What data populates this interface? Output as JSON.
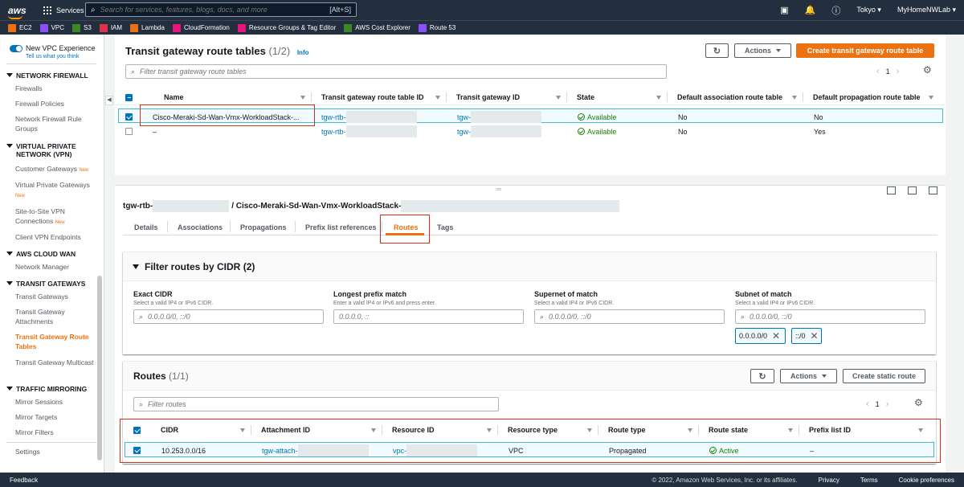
{
  "topbar": {
    "logo": "aws",
    "services": "Services",
    "search_placeholder": "Search for services, features, blogs, docs, and more",
    "search_shortcut": "[Alt+S]",
    "region": "Tokyo",
    "account": "MyHomeNWLab"
  },
  "favorites": [
    {
      "label": "EC2",
      "color": "#ec7211"
    },
    {
      "label": "VPC",
      "color": "#8c4fff"
    },
    {
      "label": "S3",
      "color": "#3f8624"
    },
    {
      "label": "IAM",
      "color": "#dd344c"
    },
    {
      "label": "Lambda",
      "color": "#ec7211"
    },
    {
      "label": "CloudFormation",
      "color": "#e7157b"
    },
    {
      "label": "Resource Groups & Tag Editor",
      "color": "#e7157b"
    },
    {
      "label": "AWS Cost Explorer",
      "color": "#3f8624"
    },
    {
      "label": "Route 53",
      "color": "#8c4fff"
    }
  ],
  "sidebar": {
    "vpc_experience": "New VPC Experience",
    "vpc_experience_sub": "Tell us what you think",
    "new_badge": "New",
    "sections": {
      "network_firewall": "NETWORK FIREWALL",
      "vpn": "VIRTUAL PRIVATE NETWORK (VPN)",
      "cloud_wan": "AWS CLOUD WAN",
      "transit_gateways": "TRANSIT GATEWAYS",
      "traffic_mirroring": "TRAFFIC MIRRORING"
    },
    "items": {
      "firewalls": "Firewalls",
      "firewall_policies": "Firewall Policies",
      "rule_groups": "Network Firewall Rule Groups",
      "customer_gateways": "Customer Gateways",
      "virtual_private_gateways": "Virtual Private Gateways",
      "s2s_vpn": "Site-to-Site VPN Connections",
      "client_vpn": "Client VPN Endpoints",
      "network_manager": "Network Manager",
      "transit_gateways": "Transit Gateways",
      "tgw_attachments": "Transit Gateway Attachments",
      "tgw_route_tables": "Transit Gateway Route Tables",
      "tgw_multicast": "Transit Gateway Multicast",
      "mirror_sessions": "Mirror Sessions",
      "mirror_targets": "Mirror Targets",
      "mirror_filters": "Mirror Filters",
      "settings": "Settings"
    }
  },
  "route_tables": {
    "title": "Transit gateway route tables",
    "count": "(1/2)",
    "info": "Info",
    "actions": "Actions",
    "create": "Create transit gateway route table",
    "filter_placeholder": "Filter transit gateway route tables",
    "page": "1",
    "columns": [
      "Name",
      "Transit gateway route table ID",
      "Transit gateway ID",
      "State",
      "Default association route table",
      "Default propagation route table"
    ],
    "rows": [
      {
        "name": "Cisco-Meraki-Sd-Wan-Vmx-WorkloadStack-...",
        "rtb": "tgw-rtb-",
        "tgw": "tgw-",
        "state": "Available",
        "assoc": "No",
        "prop": "No"
      },
      {
        "name": "–",
        "rtb": "tgw-rtb-",
        "tgw": "tgw-",
        "state": "Available",
        "assoc": "No",
        "prop": "Yes"
      }
    ]
  },
  "detail": {
    "title_rtb": "tgw-rtb-",
    "title_name": "/ Cisco-Meraki-Sd-Wan-Vmx-WorkloadStack-",
    "tabs": [
      "Details",
      "Associations",
      "Propagations",
      "Prefix list references",
      "Routes",
      "Tags"
    ]
  },
  "filter_routes": {
    "title": "Filter routes by CIDR",
    "count": "(2)",
    "fields": [
      {
        "label": "Exact CIDR",
        "desc": "Select a valid IP4 or IPv6 CIDR.",
        "placeholder": "0.0.0.0/0, ::/0"
      },
      {
        "label": "Longest prefix match",
        "desc": "Enter a valid IP4 or IPv6 and press enter.",
        "placeholder": "0.0.0.0, ::"
      },
      {
        "label": "Supernet of match",
        "desc": "Select a valid IP4 or IPv6 CIDR.",
        "placeholder": "0.0.0.0/0, ::/0"
      },
      {
        "label": "Subnet of match",
        "desc": "Select a valid IP4 or IPv6 CIDR.",
        "placeholder": "0.0.0.0/0, ::/0"
      }
    ],
    "tokens": [
      "0.0.0.0/0",
      "::/0"
    ]
  },
  "routes": {
    "title": "Routes",
    "count": "(1/1)",
    "actions": "Actions",
    "create": "Create static route",
    "filter_placeholder": "Filter routes",
    "page": "1",
    "columns": [
      "CIDR",
      "Attachment ID",
      "Resource ID",
      "Resource type",
      "Route type",
      "Route state",
      "Prefix list ID"
    ],
    "row": {
      "cidr": "10.253.0.0/16",
      "attachment": "tgw-attach-",
      "resource": "vpc-",
      "type": "VPC",
      "route_type": "Propagated",
      "state": "Active",
      "prefix": "–"
    }
  },
  "footer": {
    "feedback": "Feedback",
    "copyright": "© 2022, Amazon Web Services, Inc. or its affiliates.",
    "privacy": "Privacy",
    "terms": "Terms",
    "cookies": "Cookie preferences"
  }
}
